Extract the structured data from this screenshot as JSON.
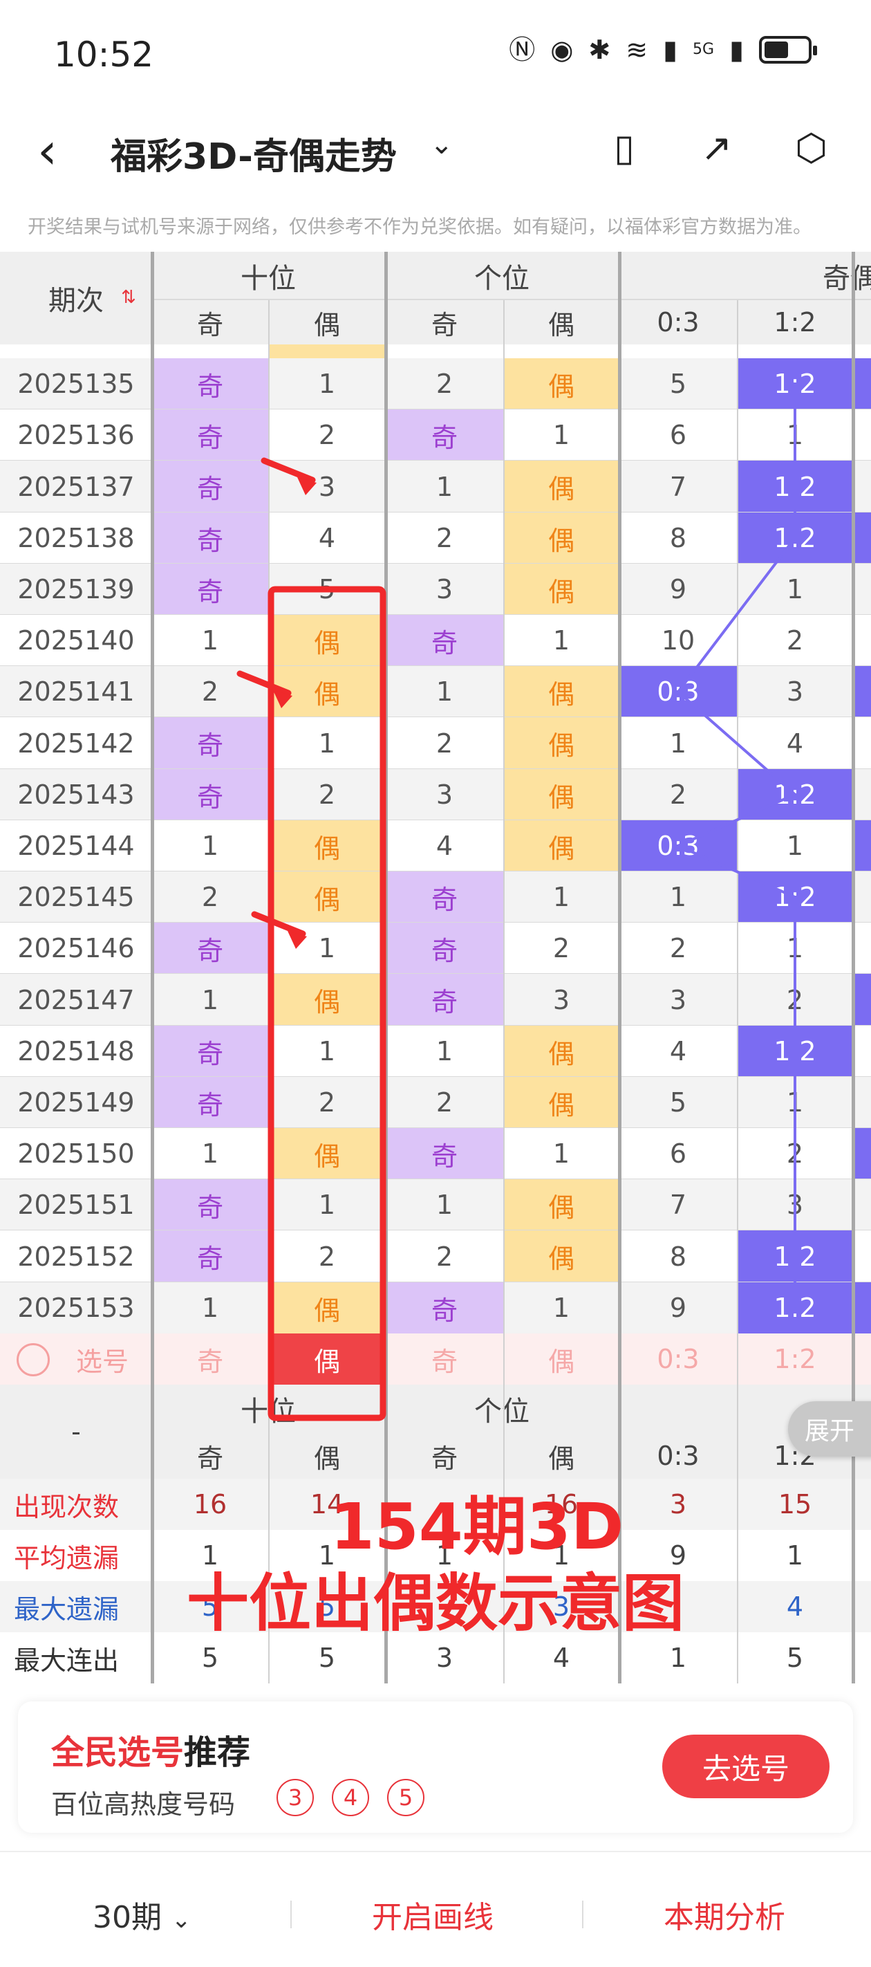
{
  "status_bar": {
    "time": "10:52",
    "network_label": "5G"
  },
  "app_bar": {
    "title": "福彩3D-奇偶走势",
    "dropdown_caret": "⌄"
  },
  "notice": "开奖结果与试机号来源于网络，仅供参考不作为兑奖依据。如有疑问，以福体彩官方数据为准。",
  "table": {
    "period_header": "期次",
    "group_tens": "十位",
    "group_units": "个位",
    "group_ratio": "奇偶比",
    "odd": "奇",
    "even": "偶",
    "ratio_labels": [
      "0:3",
      "1:2"
    ],
    "rows": [
      {
        "p": "2025135",
        "c": [
          "奇",
          "1",
          "2",
          "偶",
          "5",
          "1:2"
        ]
      },
      {
        "p": "2025136",
        "c": [
          "奇",
          "2",
          "奇",
          "1",
          "6",
          "1"
        ]
      },
      {
        "p": "2025137",
        "c": [
          "奇",
          "3",
          "1",
          "偶",
          "7",
          "1:2"
        ]
      },
      {
        "p": "2025138",
        "c": [
          "奇",
          "4",
          "2",
          "偶",
          "8",
          "1:2"
        ]
      },
      {
        "p": "2025139",
        "c": [
          "奇",
          "5",
          "3",
          "偶",
          "9",
          "1"
        ]
      },
      {
        "p": "2025140",
        "c": [
          "1",
          "偶",
          "奇",
          "1",
          "10",
          "2"
        ]
      },
      {
        "p": "2025141",
        "c": [
          "2",
          "偶",
          "1",
          "偶",
          "0:3",
          "3"
        ]
      },
      {
        "p": "2025142",
        "c": [
          "奇",
          "1",
          "2",
          "偶",
          "1",
          "4"
        ]
      },
      {
        "p": "2025143",
        "c": [
          "奇",
          "2",
          "3",
          "偶",
          "2",
          "1:2"
        ]
      },
      {
        "p": "2025144",
        "c": [
          "1",
          "偶",
          "4",
          "偶",
          "0:3",
          "1"
        ]
      },
      {
        "p": "2025145",
        "c": [
          "2",
          "偶",
          "奇",
          "1",
          "1",
          "1:2"
        ]
      },
      {
        "p": "2025146",
        "c": [
          "奇",
          "1",
          "奇",
          "2",
          "2",
          "1"
        ]
      },
      {
        "p": "2025147",
        "c": [
          "1",
          "偶",
          "奇",
          "3",
          "3",
          "2"
        ]
      },
      {
        "p": "2025148",
        "c": [
          "奇",
          "1",
          "1",
          "偶",
          "4",
          "1:2"
        ]
      },
      {
        "p": "2025149",
        "c": [
          "奇",
          "2",
          "2",
          "偶",
          "5",
          "1"
        ]
      },
      {
        "p": "2025150",
        "c": [
          "1",
          "偶",
          "奇",
          "1",
          "6",
          "2"
        ]
      },
      {
        "p": "2025151",
        "c": [
          "奇",
          "1",
          "1",
          "偶",
          "7",
          "3"
        ]
      },
      {
        "p": "2025152",
        "c": [
          "奇",
          "2",
          "2",
          "偶",
          "8",
          "1:2"
        ]
      },
      {
        "p": "2025153",
        "c": [
          "1",
          "偶",
          "奇",
          "1",
          "9",
          "1:2"
        ]
      }
    ],
    "select_row": {
      "label": "选号",
      "c": [
        "奇",
        "偶",
        "奇",
        "偶",
        "0:3",
        "1:2"
      ]
    },
    "stats_header_dash": "-",
    "stats": [
      {
        "label": "出现次数",
        "v": [
          "16",
          "14",
          "",
          "16",
          "3",
          "15"
        ]
      },
      {
        "label": "平均遗漏",
        "v": [
          "1",
          "1",
          "1",
          "1",
          "9",
          "1"
        ]
      },
      {
        "label": "最大遗漏",
        "v": [
          "5",
          "5",
          "",
          "3",
          "",
          "4"
        ]
      },
      {
        "label": "最大连出",
        "v": [
          "5",
          "5",
          "3",
          "4",
          "1",
          "5"
        ]
      }
    ]
  },
  "overlay": {
    "line1": "154期3D",
    "line2": "十位出偶数示意图"
  },
  "expand_button": "展开",
  "recommend": {
    "title_red": "全民选号",
    "title_black": "推荐",
    "subtitle": "百位高热度号码",
    "balls": [
      "3",
      "4",
      "5"
    ],
    "button": "去选号"
  },
  "bottom_bar": {
    "period": "30期",
    "draw": "开启画线",
    "analysis": "本期分析"
  },
  "colors": {
    "odd_bg": "#dcc4f8",
    "odd_text": "#9c3fd0",
    "even_bg": "#fde29f",
    "even_text": "#ef8418",
    "ratio_bg": "#7b6cf2",
    "red": "#e8333a"
  }
}
